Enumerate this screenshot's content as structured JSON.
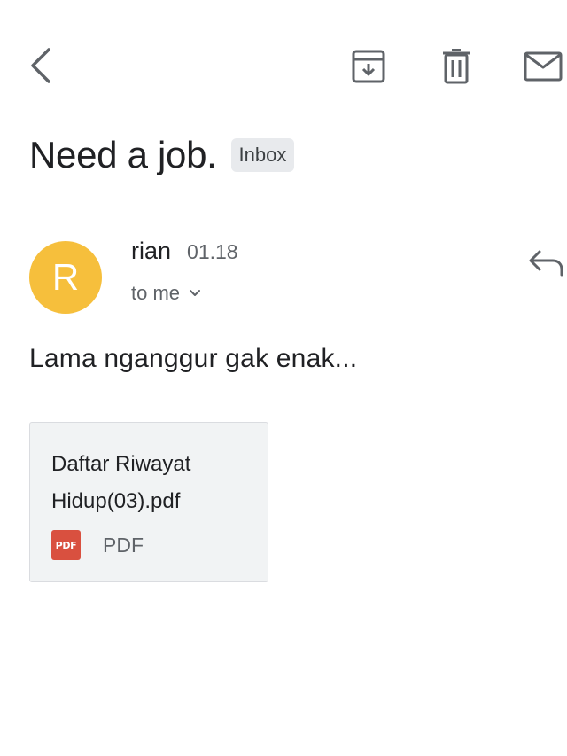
{
  "toolbar": {
    "back_icon": "chevron-left-icon",
    "archive_icon": "archive-icon",
    "delete_icon": "trash-icon",
    "mark_unread_icon": "envelope-icon"
  },
  "email": {
    "subject": "Need a job.",
    "label": "Inbox",
    "sender": {
      "initial": "R",
      "name": "rian",
      "time": "01.18",
      "avatar_color": "#f6bf3c"
    },
    "recipient": "to me",
    "body": "Lama nganggur gak enak...",
    "reply_icon": "reply-icon",
    "attachment": {
      "name": "Daftar Riwayat Hidup(03).pdf",
      "badge": "PDF",
      "type": "PDF",
      "badge_color": "#d9503f"
    }
  }
}
